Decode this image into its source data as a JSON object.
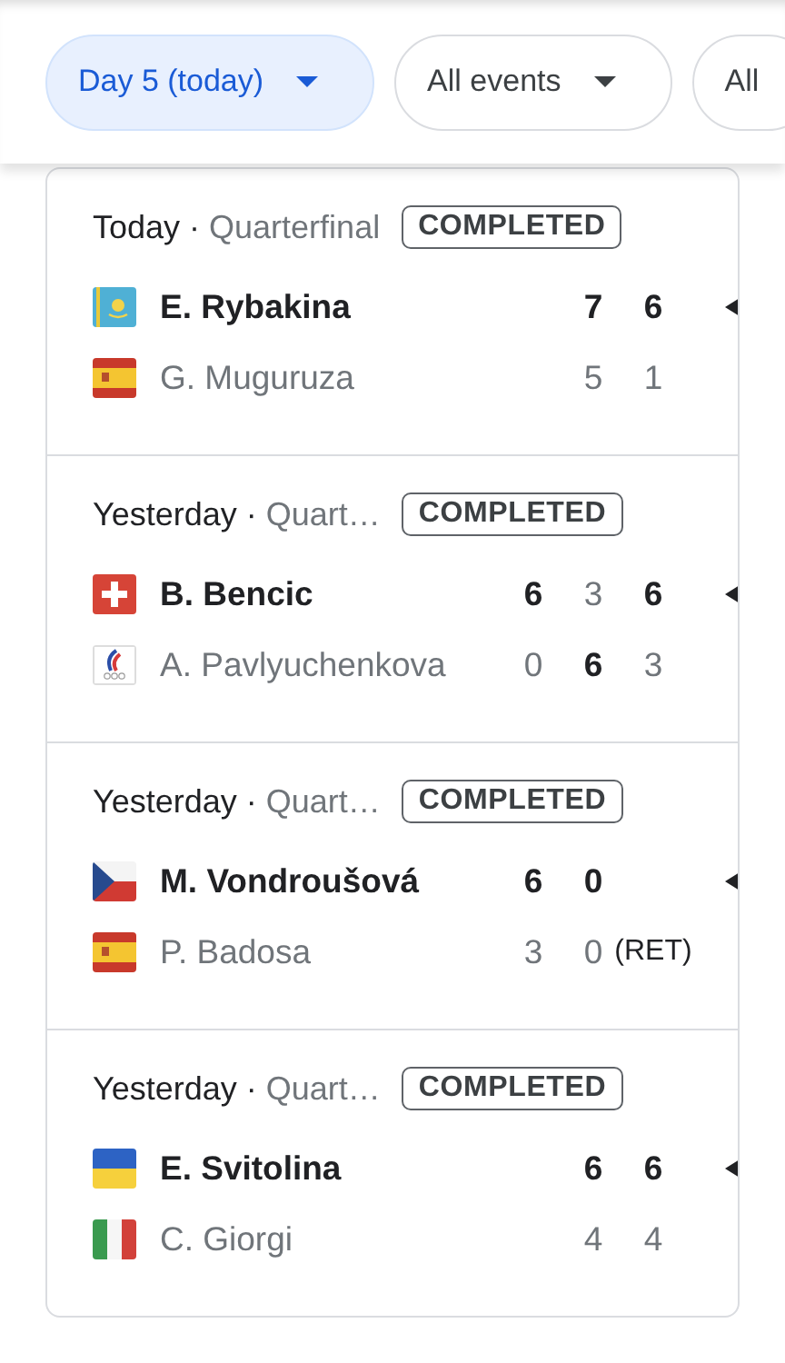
{
  "filters": [
    {
      "label": "Day 5 (today)",
      "selected": true,
      "dropdown": true
    },
    {
      "label": "All events",
      "selected": false,
      "dropdown": true
    },
    {
      "label": "All",
      "selected": false,
      "dropdown": false
    }
  ],
  "matches": [
    {
      "day": "Today",
      "separator": "·",
      "round": "Quarterfinal",
      "status": "COMPLETED",
      "players": [
        {
          "name": "E. Rybakina",
          "flag": {
            "kind": "kz"
          },
          "winner": true,
          "scores": [
            {
              "value": "7",
              "won": true
            },
            {
              "value": "6",
              "won": true
            }
          ]
        },
        {
          "name": "G. Muguruza",
          "flag": {
            "kind": "es"
          },
          "winner": false,
          "scores": [
            {
              "value": "5",
              "won": false
            },
            {
              "value": "1",
              "won": false
            }
          ]
        }
      ]
    },
    {
      "day": "Yesterday",
      "separator": "·",
      "round": "Quart…",
      "status": "COMPLETED",
      "players": [
        {
          "name": "B. Bencic",
          "flag": {
            "kind": "ch"
          },
          "winner": true,
          "scores": [
            {
              "value": "6",
              "won": true
            },
            {
              "value": "3",
              "won": false
            },
            {
              "value": "6",
              "won": true
            }
          ]
        },
        {
          "name": "A. Pavlyuchenkova",
          "flag": {
            "kind": "olympic"
          },
          "winner": false,
          "scores": [
            {
              "value": "0",
              "won": false
            },
            {
              "value": "6",
              "won": true
            },
            {
              "value": "3",
              "won": false
            }
          ]
        }
      ]
    },
    {
      "day": "Yesterday",
      "separator": "·",
      "round": "Quart…",
      "status": "COMPLETED",
      "players": [
        {
          "name": "M. Vondroušová",
          "flag": {
            "kind": "cz"
          },
          "winner": true,
          "scores": [
            {
              "value": "6",
              "won": true
            },
            {
              "value": "0",
              "won": true
            }
          ]
        },
        {
          "name": "P. Badosa",
          "flag": {
            "kind": "es"
          },
          "winner": false,
          "scores": [
            {
              "value": "3",
              "won": false
            },
            {
              "value": "0",
              "won": false
            },
            {
              "value": "(RET)",
              "won": false,
              "kind": "note"
            }
          ]
        }
      ]
    },
    {
      "day": "Yesterday",
      "separator": "·",
      "round": "Quart…",
      "status": "COMPLETED",
      "players": [
        {
          "name": "E. Svitolina",
          "flag": {
            "kind": "ua"
          },
          "winner": true,
          "scores": [
            {
              "value": "6",
              "won": true
            },
            {
              "value": "6",
              "won": true
            }
          ]
        },
        {
          "name": "C. Giorgi",
          "flag": {
            "kind": "it"
          },
          "winner": false,
          "scores": [
            {
              "value": "4",
              "won": false
            },
            {
              "value": "4",
              "won": false
            }
          ]
        }
      ]
    }
  ]
}
